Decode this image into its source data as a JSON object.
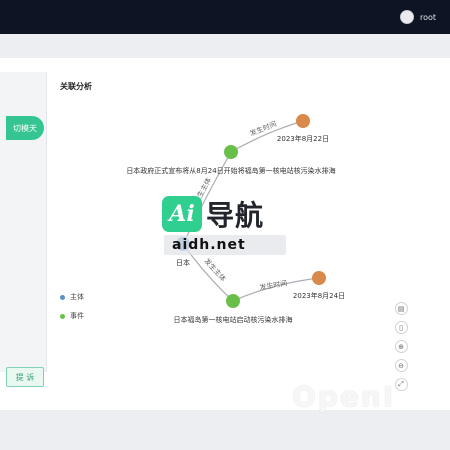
{
  "header": {
    "username": "root"
  },
  "left_panel": {
    "tab_label": "切模天",
    "submit_label": "提 诉"
  },
  "analysis": {
    "title": "关联分析",
    "nodes": [
      {
        "id": "e1",
        "label": "日本政府正式宣布将从8月24日开始将福岛第一核电站核污染水排海",
        "type": "event"
      },
      {
        "id": "t1",
        "label": "2023年8月22日",
        "type": "time"
      },
      {
        "id": "s1",
        "label": "日本",
        "type": "subject"
      },
      {
        "id": "e2",
        "label": "日本福岛第一核电站启动核污染水排海",
        "type": "event"
      },
      {
        "id": "t2",
        "label": "2023年8月24日",
        "type": "time"
      }
    ],
    "edges": [
      {
        "label": "发生时间"
      },
      {
        "label": "发生主体"
      },
      {
        "label": "发生主体"
      },
      {
        "label": "发生时间"
      }
    ],
    "legend": [
      {
        "label": "主体",
        "color": "#5b8fc7"
      },
      {
        "label": "事件",
        "color": "#6abf4b"
      }
    ],
    "colors": {
      "subject": "#5b8fc7",
      "event": "#6abf4b",
      "time": "#d9894a"
    }
  },
  "toolbar": [
    "download-icon",
    "delete-icon",
    "zoom-in-icon",
    "zoom-out-icon",
    "fullscreen-icon"
  ],
  "watermark": {
    "brand_letter": "Ai",
    "brand_text": "导航",
    "url": "aidh.net",
    "corner_text": "OpenI"
  }
}
